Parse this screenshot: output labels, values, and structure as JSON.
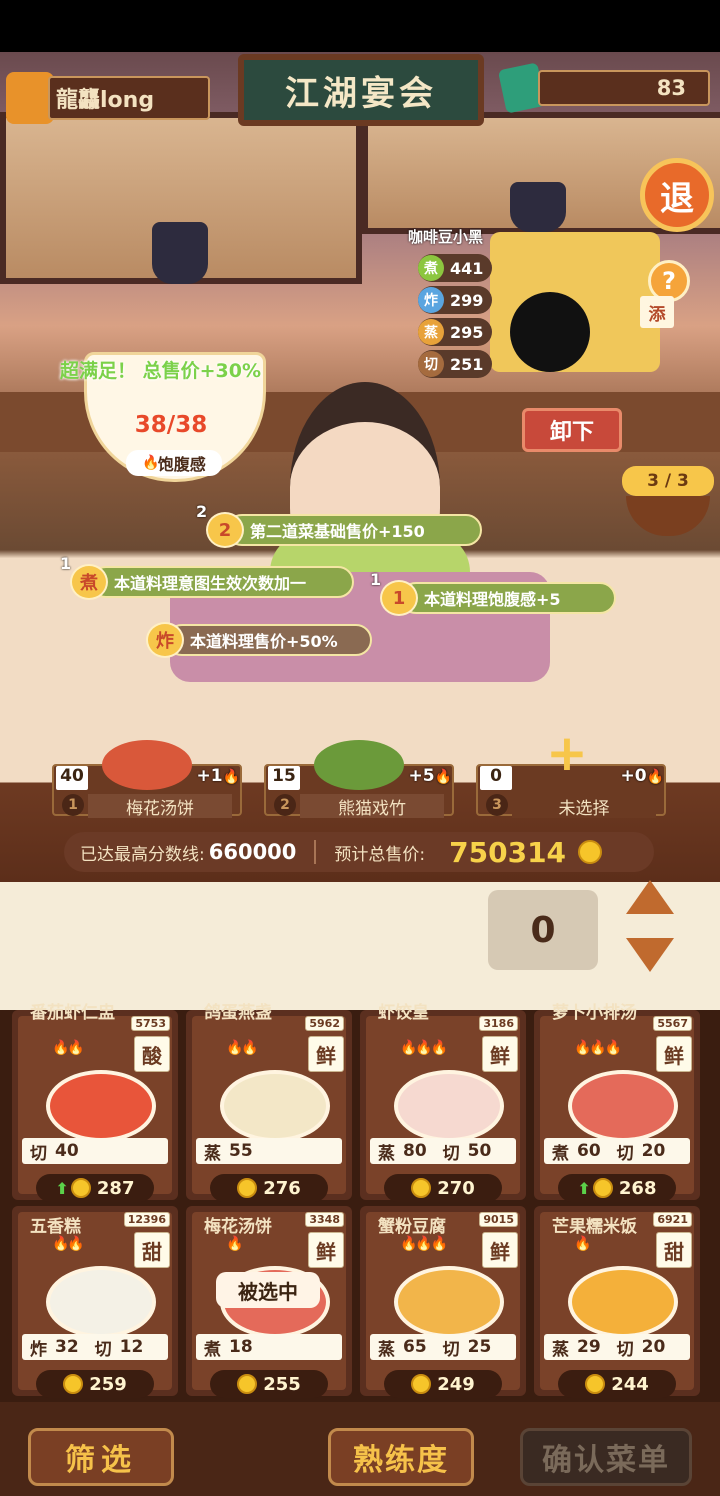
{
  "header": {
    "player_name": "龍龘long",
    "sign_title": "江湖宴会",
    "gems": "83",
    "exit_label": "退",
    "help_label": "?"
  },
  "scene": {
    "npc_name": "咖啡豆小黑",
    "stats": [
      {
        "icon": "煮",
        "value": "441",
        "color": "#8cc63f"
      },
      {
        "icon": "炸",
        "value": "299",
        "color": "#5aa5e0"
      },
      {
        "icon": "蒸",
        "value": "295",
        "color": "#e8a23a"
      },
      {
        "icon": "切",
        "value": "251",
        "color": "#a56b3e"
      }
    ],
    "add_label": "添",
    "unload_label": "卸下",
    "counter": "3 / 3",
    "satisfaction_text": "超满足！ 总售价+30%",
    "fullness_value": "38/38",
    "fullness_label": "饱腹感"
  },
  "bonuses": [
    {
      "badge": "2",
      "icon": "2",
      "text": "第二道菜基础售价+150"
    },
    {
      "badge": "1",
      "icon": "煮",
      "text": "本道料理意图生效次数加一"
    },
    {
      "badge": "1",
      "icon": "1",
      "text": "本道料理饱腹感+5"
    },
    {
      "badge": "",
      "icon": "炸",
      "text": "本道料理售价+50%"
    }
  ],
  "slots": [
    {
      "count": "40",
      "index": "1",
      "name": "梅花汤饼",
      "fullness": "+1"
    },
    {
      "count": "15",
      "index": "2",
      "name": "熊猫戏竹",
      "fullness": "+5"
    },
    {
      "count": "0",
      "index": "3",
      "name": "未选择",
      "fullness": "+0"
    }
  ],
  "score": {
    "best_label": "已达最高分数线:",
    "best_value": "660000",
    "total_label": "预计总售价:",
    "total_value": "750314"
  },
  "quantity": "0",
  "menu": [
    {
      "name": "番茄虾仁盅",
      "id": "5753",
      "taste": "酸",
      "flames": 2,
      "stats": [
        {
          "k": "切",
          "v": "40"
        }
      ],
      "price": "287",
      "up": true,
      "color": "#e8553a"
    },
    {
      "name": "鸽蛋燕盏",
      "id": "5962",
      "taste": "鲜",
      "flames": 2,
      "stats": [
        {
          "k": "蒸",
          "v": "55"
        }
      ],
      "price": "276",
      "up": false,
      "color": "#f3e7c7"
    },
    {
      "name": "虾饺皇",
      "id": "3186",
      "taste": "鲜",
      "flames": 3,
      "stats": [
        {
          "k": "蒸",
          "v": "80"
        },
        {
          "k": "切",
          "v": "50"
        }
      ],
      "price": "270",
      "up": false,
      "color": "#f6d9d0"
    },
    {
      "name": "萝卜小排汤",
      "id": "5567",
      "taste": "鲜",
      "flames": 3,
      "stats": [
        {
          "k": "煮",
          "v": "60"
        },
        {
          "k": "切",
          "v": "20"
        }
      ],
      "price": "268",
      "up": true,
      "color": "#e46a5a"
    },
    {
      "name": "五香糕",
      "id": "12396",
      "taste": "甜",
      "flames": 2,
      "stats": [
        {
          "k": "炸",
          "v": "32"
        },
        {
          "k": "切",
          "v": "12"
        }
      ],
      "price": "259",
      "up": false,
      "color": "#f4f1e6"
    },
    {
      "name": "梅花汤饼",
      "id": "3348",
      "taste": "鲜",
      "flames": 1,
      "stats": [
        {
          "k": "煮",
          "v": "18"
        }
      ],
      "price": "255",
      "up": false,
      "color": "#e46a5a",
      "selected": "被选中"
    },
    {
      "name": "蟹粉豆腐",
      "id": "9015",
      "taste": "鲜",
      "flames": 3,
      "stats": [
        {
          "k": "蒸",
          "v": "65"
        },
        {
          "k": "切",
          "v": "25"
        }
      ],
      "price": "249",
      "up": false,
      "color": "#f2b54a"
    },
    {
      "name": "芒果糯米饭",
      "id": "6921",
      "taste": "甜",
      "flames": 1,
      "stats": [
        {
          "k": "蒸",
          "v": "29"
        },
        {
          "k": "切",
          "v": "20"
        }
      ],
      "price": "244",
      "up": false,
      "color": "#f4b03a"
    }
  ],
  "bottom": {
    "filter_label": "筛选",
    "proficiency_label": "熟练度",
    "confirm_label": "确认菜单"
  }
}
